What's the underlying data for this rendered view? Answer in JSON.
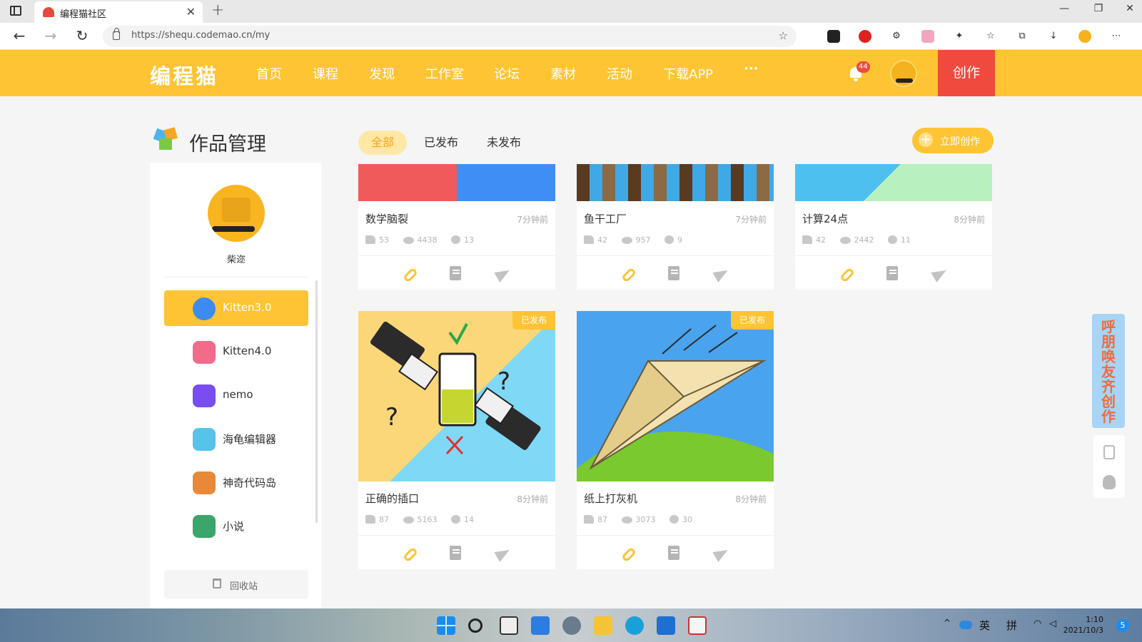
{
  "browser": {
    "tab_title": "编程猫社区",
    "tab_close": "✕",
    "new_tab": "+",
    "url": "https://shequ.codemao.cn/my",
    "window_minimize": "—",
    "window_restore": "❐",
    "window_close": "✕",
    "back": "←",
    "forward": "→",
    "refresh": "↻",
    "more": "⋯"
  },
  "header": {
    "logo": "编程猫",
    "nav": [
      "首页",
      "课程",
      "发现",
      "工作室",
      "论坛",
      "素材",
      "活动",
      "下载APP",
      "···"
    ],
    "notifications_count": "44",
    "create_label": "创作"
  },
  "page": {
    "title": "作品管理",
    "tabs": [
      "全部",
      "已发布",
      "未发布"
    ],
    "active_tab": "全部",
    "quick_create": "立即创作"
  },
  "sidebar": {
    "username": "柴迩",
    "items": [
      {
        "label": "Kitten3.0",
        "icon": "kitten3-icon",
        "color": "#3d8bf0"
      },
      {
        "label": "Kitten4.0",
        "icon": "kitten4-icon",
        "color": "#f26b8a"
      },
      {
        "label": "nemo",
        "icon": "nemo-icon",
        "color": "#7a4df0"
      },
      {
        "label": "海龟编辑器",
        "icon": "turtle-editor-icon",
        "color": "#56c3e8"
      },
      {
        "label": "神奇代码岛",
        "icon": "code-island-icon",
        "color": "#e8893a"
      },
      {
        "label": "小说",
        "icon": "novel-icon",
        "color": "#3aa66b"
      }
    ],
    "active_item": "Kitten3.0",
    "recycle_label": "回收站"
  },
  "works": [
    {
      "name": "数学脑裂",
      "time": "7分钟前",
      "likes": "53",
      "views": "4438",
      "comments": "13",
      "published": false
    },
    {
      "name": "鱼干工厂",
      "time": "7分钟前",
      "likes": "42",
      "views": "957",
      "comments": "9",
      "published": false
    },
    {
      "name": "计算24点",
      "time": "8分钟前",
      "likes": "42",
      "views": "2442",
      "comments": "11",
      "published": false
    },
    {
      "name": "正确的插口",
      "time": "8分钟前",
      "likes": "87",
      "views": "5163",
      "comments": "14",
      "published": true,
      "badge": "已发布"
    },
    {
      "name": "纸上打灰机",
      "time": "8分钟前",
      "likes": "87",
      "views": "3073",
      "comments": "30",
      "published": true,
      "badge": "已发布"
    }
  ],
  "float_banner": "呼朋唤友齐创作",
  "taskbar": {
    "ime_lang": "英",
    "ime_mode": "拼",
    "time": "1:10",
    "date": "2021/10/3",
    "notifications": "5"
  },
  "colors": {
    "brand": "#fec433",
    "create": "#f04a3e",
    "badge": "#fec433"
  }
}
